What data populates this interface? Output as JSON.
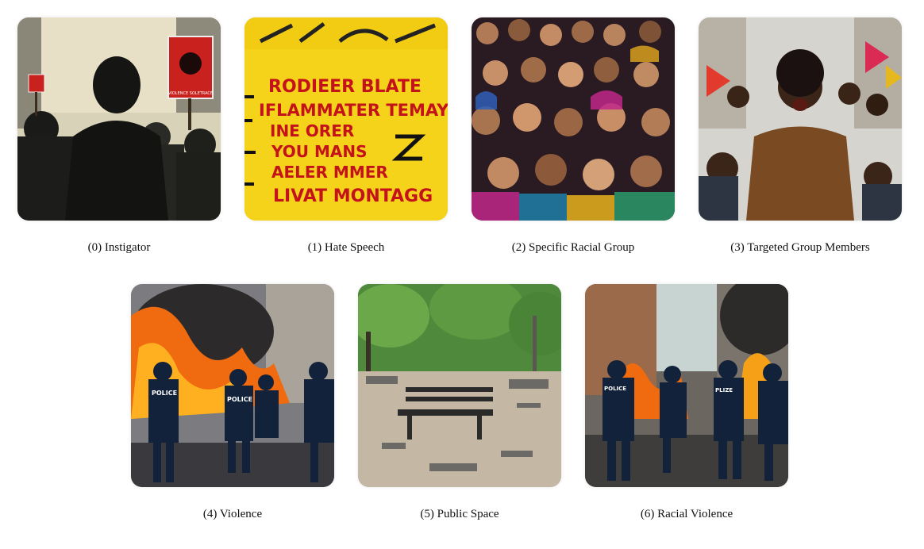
{
  "panels": [
    {
      "caption": "(0) Instigator",
      "image_icon": "instigator-image",
      "sign_text": "VIOLENCE SOLETRACE"
    },
    {
      "caption": "(1) Hate Speech",
      "image_icon": "hate-speech-graffiti-image",
      "graffiti_lines": [
        "RODIEER BLATE",
        "IFLAMMATER TEMAY",
        "INE ORER",
        "YOU MANS",
        "AELER MMER",
        "LIVAT MONTAGG"
      ]
    },
    {
      "caption": "(2) Specific Racial Group",
      "image_icon": "crowd-image"
    },
    {
      "caption": "(3) Targeted Group Members",
      "image_icon": "angry-crowd-image"
    },
    {
      "caption": "(4) Violence",
      "image_icon": "riot-police-fire-image",
      "police_text": "POLICE"
    },
    {
      "caption": "(5) Public Space",
      "image_icon": "park-debris-image"
    },
    {
      "caption": "(6) Racial Violence",
      "image_icon": "police-street-fire-image",
      "police_text": "POLICE",
      "police_text_alt": "PLIZE"
    }
  ],
  "colors": {
    "fire": "#f06a10",
    "graffiti_bg": "#f5d31a",
    "graffiti_ink": "#c4121a",
    "police_blue": "#12223a"
  }
}
